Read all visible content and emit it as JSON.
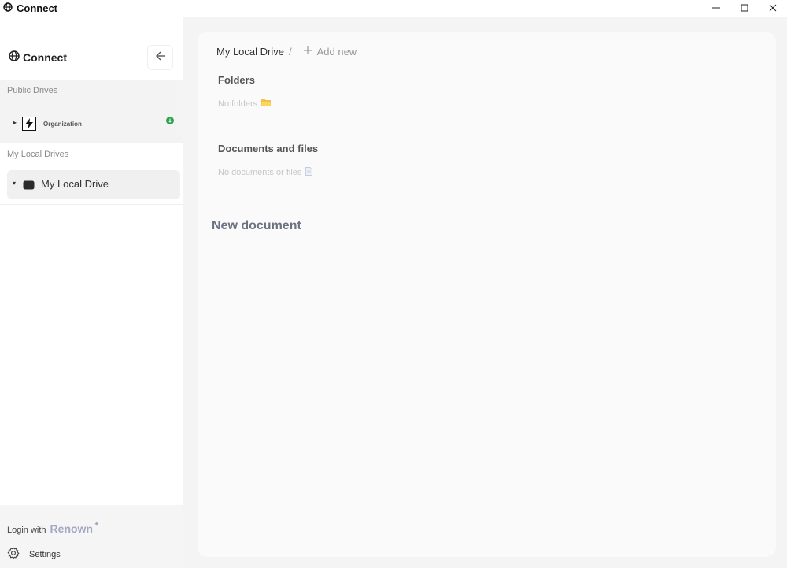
{
  "window": {
    "title": "Connect",
    "minimize_icon": "minimize-icon",
    "maximize_icon": "maximize-icon",
    "close_icon": "close-icon"
  },
  "sidebar": {
    "logo_text": "Connect",
    "back_icon": "arrow-left-icon",
    "public_drives": {
      "title": "Public Drives",
      "items": [
        {
          "label": "Organization",
          "expanded": false,
          "status": "synced"
        }
      ]
    },
    "local_drives": {
      "title": "My Local Drives",
      "items": [
        {
          "label": "My Local Drive",
          "expanded": true,
          "selected": true
        }
      ]
    },
    "footer": {
      "login_prefix": "Login with",
      "login_brand": "Renown",
      "login_spark": "✦",
      "settings_label": "Settings"
    }
  },
  "main": {
    "breadcrumb": {
      "current": "My Local Drive",
      "separator": "/",
      "add_new": "Add new"
    },
    "folders": {
      "title": "Folders",
      "empty_text": "No folders"
    },
    "documents": {
      "title": "Documents and files",
      "empty_text": "No documents or files"
    },
    "new_document_title": "New document"
  },
  "colors": {
    "sidebar_bg": "#ffffff",
    "page_bg": "#f4f4f4",
    "panel_bg": "#fafafa",
    "selected_row": "#f0f0f1",
    "status_green": "#2ea44f",
    "renown": "#a3a8c2"
  }
}
